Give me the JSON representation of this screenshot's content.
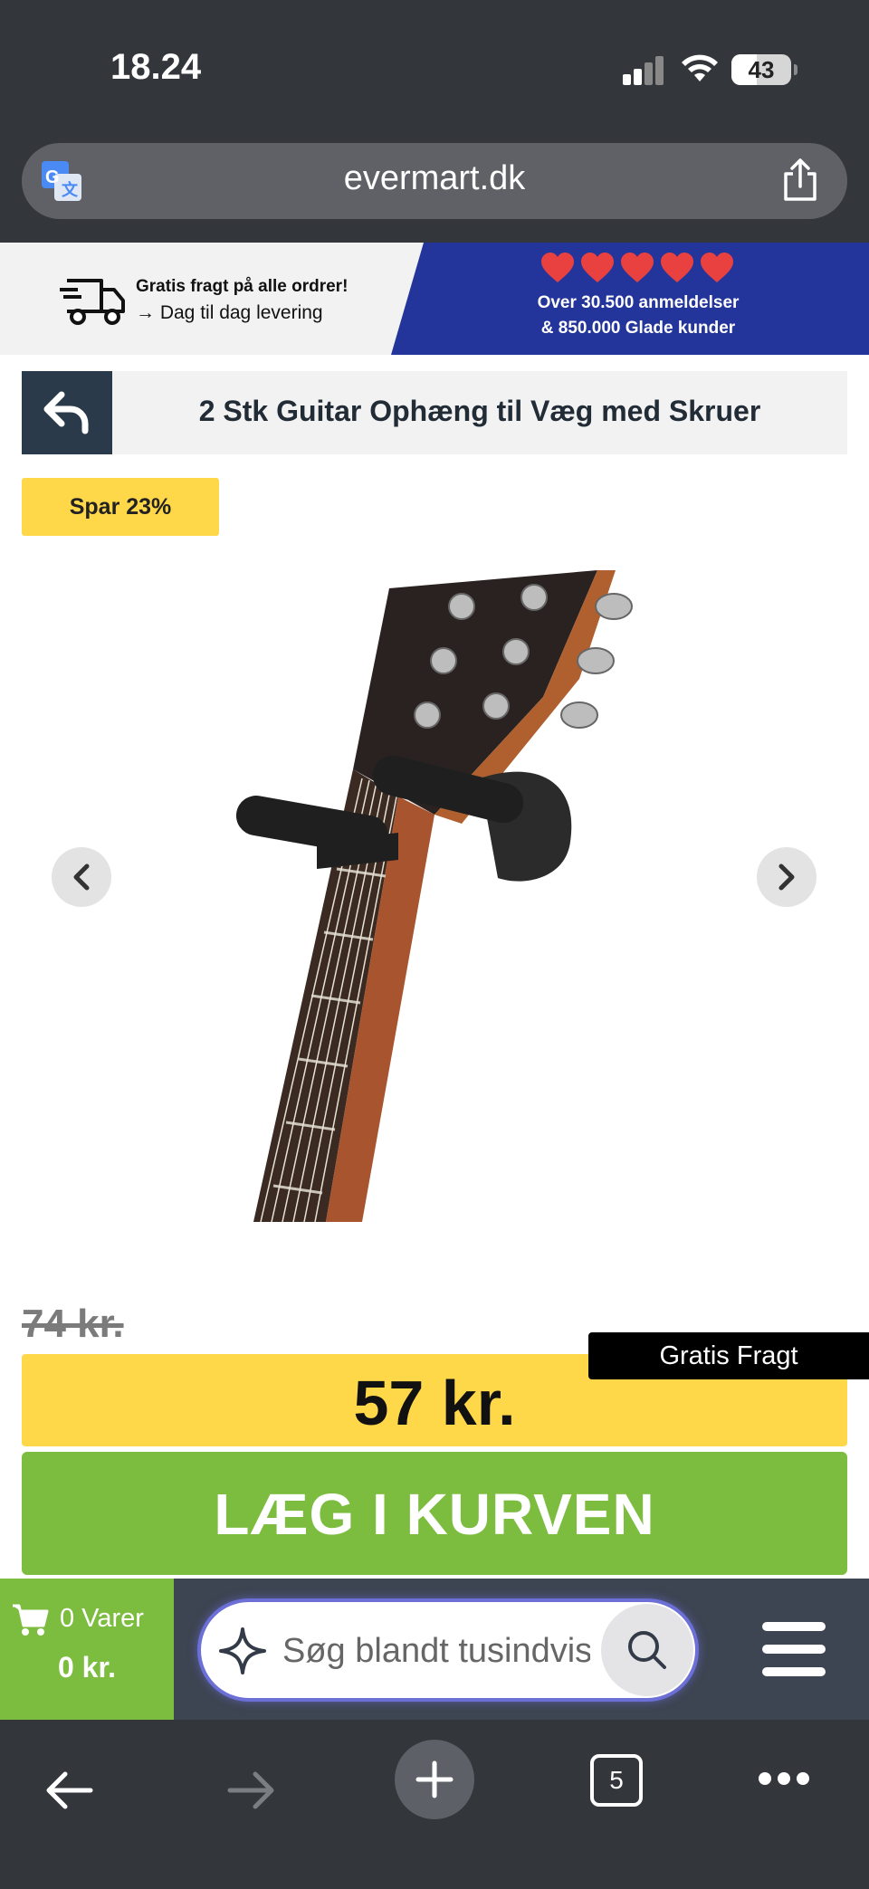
{
  "status_bar": {
    "time": "18.24",
    "battery": "43",
    "battery_level": 0.43
  },
  "browser": {
    "url": "evermart.dk",
    "tab_count": "5"
  },
  "promo": {
    "free_shipping_title": "Gratis fragt på alle ordrer!",
    "delivery_text": "→ Dag til dag levering",
    "reviews_line1": "Over 30.500 anmeldelser",
    "reviews_line2": "& 850.000 Glade kunder",
    "hearts": 5,
    "heart_color": "#e8413f",
    "banner_color": "#23359a"
  },
  "product": {
    "title": "2 Stk Guitar Ophæng til Væg med Skruer",
    "save_badge": "Spar 23%",
    "old_price": "74 kr.",
    "price": "57 kr.",
    "free_shipping_label": "Gratis Fragt",
    "add_to_cart": "LÆG I KURVEN"
  },
  "site_bar": {
    "cart_count": "0 Varer",
    "cart_total": "0 kr.",
    "search_placeholder": "Søg blandt tusindvis af produkter"
  },
  "colors": {
    "accent_yellow": "#ffd84a",
    "accent_green": "#7cbd40",
    "dark_navy": "#2b3a4a"
  }
}
